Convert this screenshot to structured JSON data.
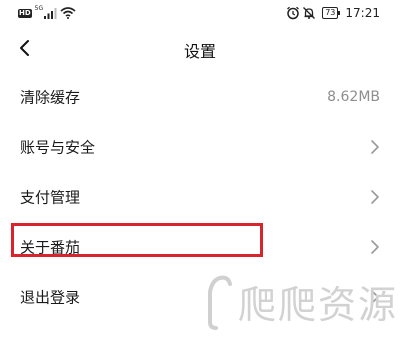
{
  "status_bar": {
    "network_badge": "HD",
    "network_type": "5G",
    "battery": "73",
    "time": "17:21",
    "icons": [
      "hd-icon",
      "signal-icon",
      "wifi-icon",
      "alarm-icon",
      "mute-icon",
      "battery-icon"
    ]
  },
  "header": {
    "title": "设置",
    "back_icon": "back-arrow-icon"
  },
  "settings": {
    "items": [
      {
        "label": "清除缓存",
        "value": "8.62MB"
      },
      {
        "label": "账号与安全"
      },
      {
        "label": "支付管理"
      },
      {
        "label": "关于番茄"
      },
      {
        "label": "退出登录"
      }
    ]
  },
  "highlight": {
    "color": "#d9232d",
    "target": "关于番茄"
  },
  "watermark": {
    "text": "爬爬资源"
  },
  "colors": {
    "background": "#ffffff",
    "text": "#1a1a1a",
    "secondary": "#8e8e8e",
    "chevron": "#9a9a9a"
  }
}
